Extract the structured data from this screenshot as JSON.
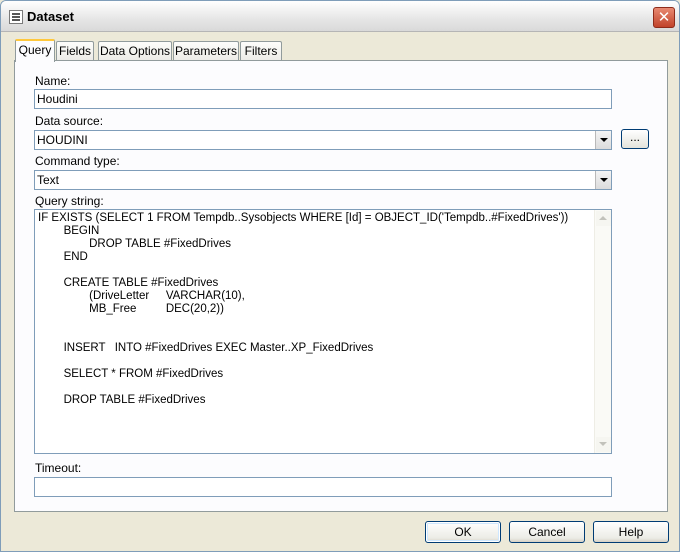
{
  "window": {
    "title": "Dataset",
    "close_glyph": "✕"
  },
  "tabs": [
    {
      "label": "Query",
      "active": true
    },
    {
      "label": "Fields",
      "active": false
    },
    {
      "label": "Data Options",
      "active": false
    },
    {
      "label": "Parameters",
      "active": false
    },
    {
      "label": "Filters",
      "active": false
    }
  ],
  "form": {
    "name_label": "Name:",
    "name_value": "Houdini",
    "data_source_label": "Data source:",
    "data_source_value": "HOUDINI",
    "data_source_button": "...",
    "command_type_label": "Command type:",
    "command_type_value": "Text",
    "query_string_label": "Query string:",
    "query_string_value": "IF EXISTS (SELECT 1 FROM Tempdb..Sysobjects WHERE [Id] = OBJECT_ID('Tempdb..#FixedDrives'))\n\t\tBEGIN\n\t\t\t\tDROP TABLE #FixedDrives\n\t\tEND\n\n\t\tCREATE TABLE #FixedDrives\n\t\t\t\t(DriveLetter\t\tVARCHAR(10),\n\t\t\t\tMB_Free\t\t\tDEC(20,2))\n\n\n\t\tINSERT\tINTO #FixedDrives EXEC Master..XP_FixedDrives\n\n\t\tSELECT * FROM #FixedDrives\n\n\t\tDROP TABLE #FixedDrives",
    "timeout_label": "Timeout:",
    "timeout_value": ""
  },
  "buttons": {
    "ok": "OK",
    "cancel": "Cancel",
    "help": "Help"
  }
}
